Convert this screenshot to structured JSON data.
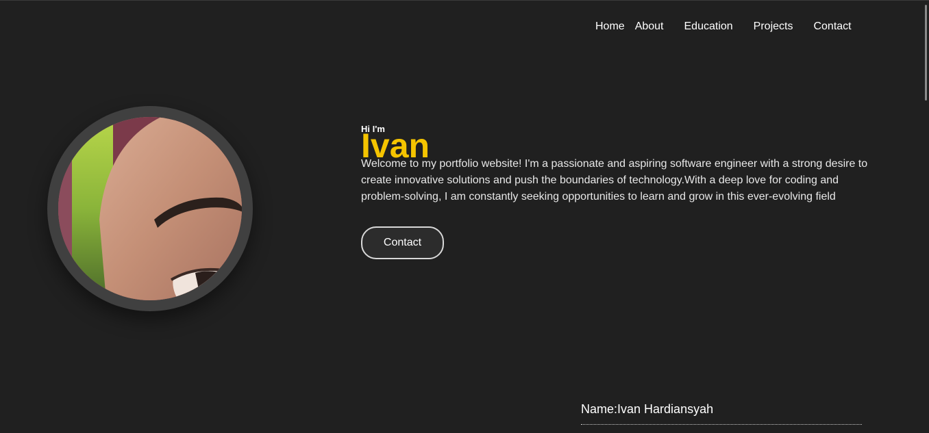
{
  "nav": {
    "items": [
      {
        "label": "Home"
      },
      {
        "label": "About"
      },
      {
        "label": "Education"
      },
      {
        "label": "Projects"
      },
      {
        "label": "Contact"
      }
    ]
  },
  "hero": {
    "greeting": "Hi I'm",
    "name": "Ivan",
    "description": "Welcome to my portfolio website! I'm a passionate and aspiring software engineer with a strong desire to create innovative solutions and push the boundaries of technology.With a deep love for coding and problem-solving, I am constantly seeking opportunities to learn and grow in this ever-evolving field",
    "contact_button": "Contact"
  },
  "about": {
    "name_line": "Name:Ivan Hardiansyah"
  },
  "colors": {
    "background": "#202020",
    "accent": "#f5c400",
    "ring": "#404040"
  }
}
